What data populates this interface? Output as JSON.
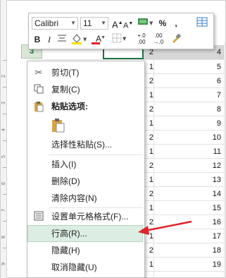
{
  "ruler": {
    "marks": [
      "1",
      "2",
      "3",
      "4",
      "5",
      "6",
      "7",
      "8",
      "9"
    ]
  },
  "sheet": {
    "selected_row_header": "3",
    "selected_row_value": "4",
    "rows": [
      {
        "a": "2",
        "b": "4"
      },
      {
        "a": "1",
        "b": "5"
      },
      {
        "a": "2",
        "b": "6"
      },
      {
        "a": "1",
        "b": "7"
      },
      {
        "a": "2",
        "b": "8"
      },
      {
        "a": "1",
        "b": "9"
      },
      {
        "a": "2",
        "b": "10"
      },
      {
        "a": "1",
        "b": "11"
      },
      {
        "a": "2",
        "b": "12"
      },
      {
        "a": "1",
        "b": "13"
      },
      {
        "a": "2",
        "b": "14"
      },
      {
        "a": "1",
        "b": "15"
      },
      {
        "a": "2",
        "b": "16"
      },
      {
        "a": "1",
        "b": "17"
      },
      {
        "a": "2",
        "b": "18"
      },
      {
        "a": "1",
        "b": "19"
      }
    ]
  },
  "mini_toolbar": {
    "font_name": "Calibri",
    "font_size": "11",
    "grow_font": "A",
    "shrink_font": "A",
    "percent": "%",
    "comma": ",",
    "bold": "B",
    "italic": "I",
    "font_color_label": "A",
    "dec_increase": "+.0",
    "dec_decrease": ".00"
  },
  "context_menu": {
    "items": [
      {
        "label": "剪切(T)",
        "icon": "scissors-icon"
      },
      {
        "label": "复制(C)",
        "icon": "copy-icon"
      },
      {
        "label": "粘贴选项:",
        "icon": "paste-icon"
      },
      {
        "label": "",
        "icon": "paste-option-icon"
      },
      {
        "label": "选择性粘贴(S)...",
        "icon": ""
      },
      {
        "label": "插入(I)",
        "icon": ""
      },
      {
        "label": "删除(D)",
        "icon": ""
      },
      {
        "label": "清除内容(N)",
        "icon": ""
      },
      {
        "label": "设置单元格格式(F)...",
        "icon": "format-cells-icon"
      },
      {
        "label": "行高(R)...",
        "icon": ""
      },
      {
        "label": "隐藏(H)",
        "icon": ""
      },
      {
        "label": "取消隐藏(U)",
        "icon": ""
      }
    ],
    "highlighted_index": 9
  },
  "colors": {
    "accent": "#217346",
    "arrow": "#e0222a",
    "menu_highlight": "#dcede3"
  }
}
